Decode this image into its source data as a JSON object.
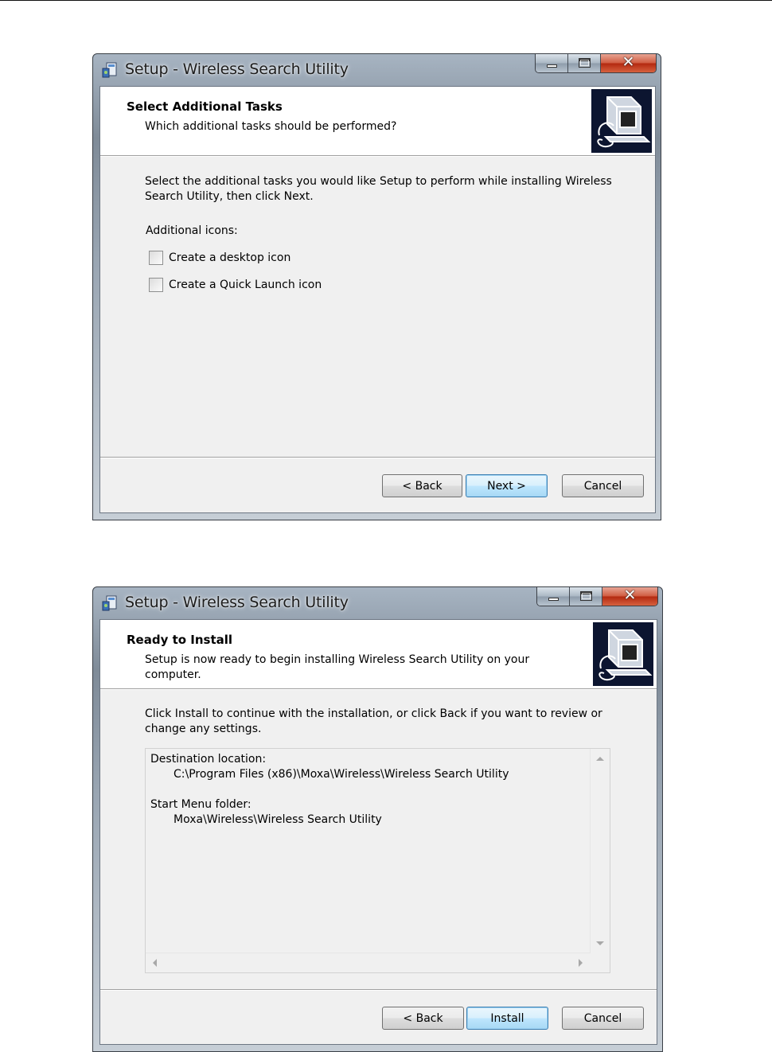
{
  "dialogs": [
    {
      "window_title": "Setup - Wireless Search Utility",
      "header_title": "Select Additional Tasks",
      "header_subtitle": "Which additional tasks should be performed?",
      "instruction": "Select the additional tasks you would like Setup to perform while installing Wireless Search Utility, then click Next.",
      "group_label": "Additional icons:",
      "checkboxes": [
        {
          "label": "Create a desktop icon",
          "checked": false
        },
        {
          "label": "Create a Quick Launch icon",
          "checked": false
        }
      ],
      "buttons": {
        "back": "< Back",
        "next": "Next >",
        "cancel": "Cancel"
      }
    },
    {
      "window_title": "Setup - Wireless Search Utility",
      "header_title": "Ready to Install",
      "header_subtitle": "Setup is now ready to begin installing Wireless Search Utility on your computer.",
      "instruction": "Click Install to continue with the installation, or click Back if you want to review or change any settings.",
      "summary": {
        "dest_label": "Destination location:",
        "dest_value": "C:\\Program Files (x86)\\Moxa\\Wireless\\Wireless Search Utility",
        "menu_label": "Start Menu folder:",
        "menu_value": "Moxa\\Wireless\\Wireless Search Utility"
      },
      "buttons": {
        "back": "< Back",
        "install": "Install",
        "cancel": "Cancel"
      }
    }
  ],
  "colors": {
    "close_button": "#c8442a",
    "default_button_border": "#3c7fb1",
    "wizard_image_bg": "#0c1530"
  },
  "icons": [
    "setup-app-icon",
    "minimize-icon",
    "maximize-icon",
    "close-icon",
    "wizard-computer-image"
  ]
}
